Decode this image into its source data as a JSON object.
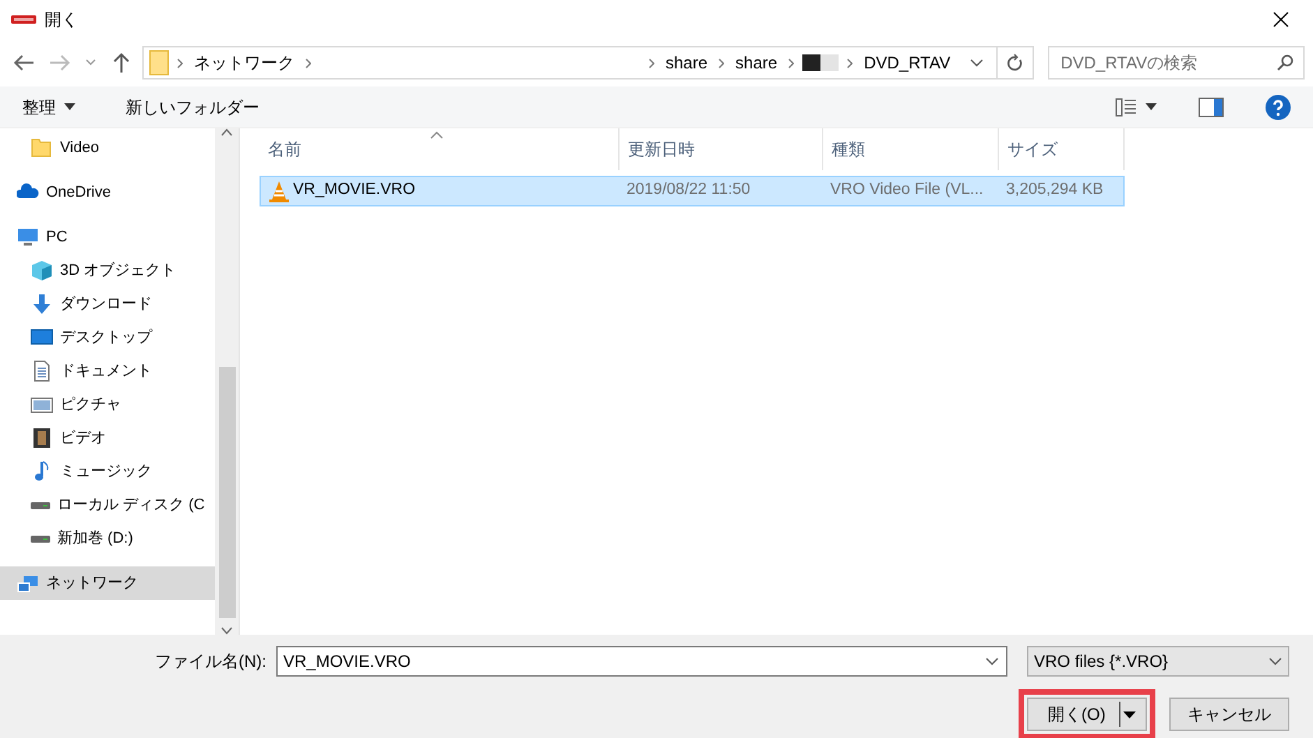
{
  "window": {
    "title": "開く"
  },
  "address": {
    "segments": [
      {
        "kind": "text",
        "text": "ネットワーク"
      },
      {
        "kind": "blank"
      },
      {
        "kind": "text",
        "text": "share"
      },
      {
        "kind": "text",
        "text": "share"
      },
      {
        "kind": "redacted"
      },
      {
        "kind": "text",
        "text": "DVD_RTAV"
      }
    ]
  },
  "search": {
    "placeholder": "DVD_RTAVの検索"
  },
  "toolbar": {
    "organize": "整理",
    "new_folder": "新しいフォルダー"
  },
  "sidebar": {
    "items": [
      {
        "children": [
          {
            "label": "Video",
            "kind": "folder",
            "selected": false
          }
        ]
      },
      {
        "label": "OneDrive",
        "kind": "cloud",
        "selected": false
      },
      {
        "label": "PC",
        "kind": "pc",
        "selected": false,
        "children": [
          {
            "label": "3D オブジェクト",
            "kind": "cube",
            "selected": false
          },
          {
            "label": "ダウンロード",
            "kind": "download",
            "selected": false
          },
          {
            "label": "デスクトップ",
            "kind": "desktop",
            "selected": false
          },
          {
            "label": "ドキュメント",
            "kind": "document",
            "selected": false
          },
          {
            "label": "ピクチャ",
            "kind": "picture",
            "selected": false
          },
          {
            "label": "ビデオ",
            "kind": "film",
            "selected": false
          },
          {
            "label": "ミュージック",
            "kind": "music",
            "selected": false
          },
          {
            "label": "ローカル ディスク (C",
            "kind": "drive",
            "selected": false
          },
          {
            "label": "新加巻 (D:)",
            "kind": "drive",
            "selected": false
          }
        ]
      },
      {
        "label": "ネットワーク",
        "kind": "network",
        "selected": true
      }
    ]
  },
  "table": {
    "columns": [
      {
        "label": "名前",
        "sorted": true
      },
      {
        "label": "更新日時",
        "sorted": false
      },
      {
        "label": "種類",
        "sorted": false
      },
      {
        "label": "サイズ",
        "sorted": false
      }
    ],
    "rows": [
      {
        "name": "VR_MOVIE.VRO",
        "modified": "2019/08/22 11:50",
        "type": "VRO Video File (VL...",
        "size": "3,205,294 KB",
        "selected": true
      }
    ]
  },
  "footer": {
    "filename_label": "ファイル名(N):",
    "filename": "VR_MOVIE.VRO",
    "filter": "VRO files {*.VRO}",
    "buttons": [
      {
        "kind": "split",
        "label": "開く(O)",
        "highlighted": true
      },
      {
        "kind": "plain",
        "label": "キャンセル",
        "highlighted": false
      }
    ]
  }
}
